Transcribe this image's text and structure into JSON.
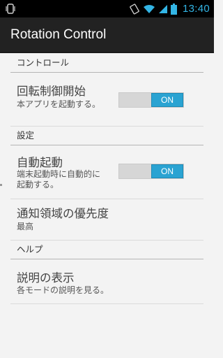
{
  "status_bar": {
    "time": "13:40",
    "icons": [
      "vibrate-icon",
      "rotate-icon",
      "wifi-icon",
      "signal-icon",
      "battery-icon"
    ],
    "accent_color": "#33b5e5"
  },
  "action_bar": {
    "title": "Rotation Control"
  },
  "sections": {
    "control": {
      "header": "コントロール",
      "rotation": {
        "title": "回転制御開始",
        "summary": "本アプリを起動する。",
        "toggle": "ON"
      }
    },
    "settings": {
      "header": "設定",
      "auto_start": {
        "title": "自動起動",
        "summary": "端末起動時に自動的に起動する。",
        "toggle": "ON"
      },
      "notification_priority": {
        "title": "通知領域の優先度",
        "summary": "最高"
      }
    },
    "help": {
      "header": "ヘルプ",
      "description": {
        "title": "説明の表示",
        "summary": "各モードの説明を見る。"
      }
    }
  },
  "colors": {
    "toggle_on": "#2aa3d2",
    "action_bar": "#222222",
    "background": "#f3f3f3"
  }
}
